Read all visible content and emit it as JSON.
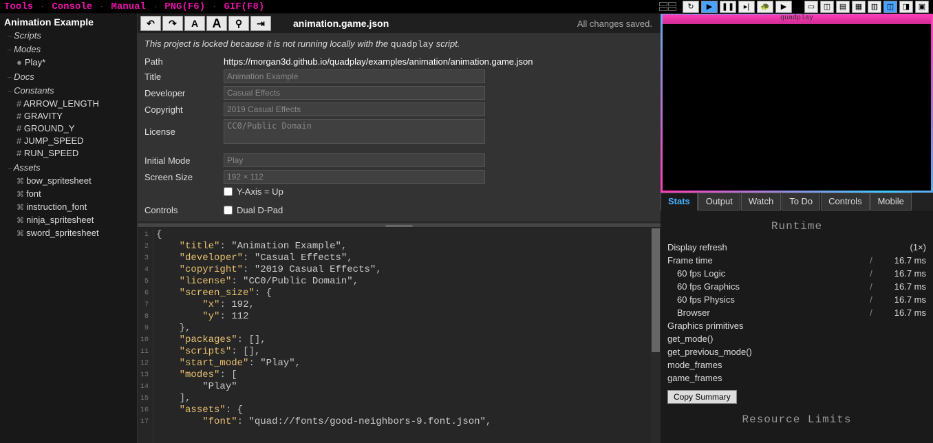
{
  "topmenu": [
    "Tools",
    "Console",
    "Manual",
    "PNG(F6)",
    "GIF(F8)"
  ],
  "project_title": "Animation Example",
  "sidebar": {
    "sections": [
      {
        "name": "Scripts",
        "items": []
      },
      {
        "name": "Modes",
        "items": [
          {
            "label": "Play*",
            "icon": "●"
          }
        ]
      },
      {
        "name": "Docs",
        "items": []
      },
      {
        "name": "Constants",
        "items": [
          "ARROW_LENGTH",
          "GRAVITY",
          "GROUND_Y",
          "JUMP_SPEED",
          "RUN_SPEED"
        ]
      },
      {
        "name": "Assets",
        "items": [
          "bow_spritesheet",
          "font",
          "instruction_font",
          "ninja_spritesheet",
          "sword_spritesheet"
        ]
      }
    ]
  },
  "editor": {
    "filename": "animation.game.json",
    "saved_msg": "All changes saved.",
    "lock_msg_prefix": "This project is locked because it is not running locally with the ",
    "lock_msg_script": "quadplay",
    "lock_msg_suffix": " script.",
    "toolbar_btns": [
      "↶",
      "↷",
      "A",
      "A",
      "⚲",
      "⇥"
    ],
    "fields": {
      "path_label": "Path",
      "path": "https://morgan3d.github.io/quadplay/examples/animation/animation.game.json",
      "title_label": "Title",
      "title": "Animation Example",
      "developer_label": "Developer",
      "developer": "Casual Effects",
      "copyright_label": "Copyright",
      "copyright": "2019 Casual Effects",
      "license_label": "License",
      "license": "CC0/Public Domain",
      "initmode_label": "Initial Mode",
      "initmode": "Play",
      "screensize_label": "Screen Size",
      "screensize": "192 × 112",
      "yaxis_label": "Y-Axis = Up",
      "controls_label": "Controls",
      "dualdpad_label": "Dual D-Pad"
    },
    "code_lines": [
      "{",
      "    \"title\": \"Animation Example\",",
      "    \"developer\": \"Casual Effects\",",
      "    \"copyright\": \"2019 Casual Effects\",",
      "    \"license\": \"CC0/Public Domain\",",
      "    \"screen_size\": {",
      "        \"x\": 192,",
      "        \"y\": 112",
      "    },",
      "    \"packages\": [],",
      "    \"scripts\": [],",
      "    \"start_mode\": \"Play\",",
      "    \"modes\": [",
      "        \"Play\"",
      "    ],",
      "    \"assets\": {",
      "        \"font\": \"quad://fonts/good-neighbors-9.font.json\","
    ]
  },
  "right": {
    "brand": "quadplay",
    "tabs": [
      "Stats",
      "Output",
      "Watch",
      "To Do",
      "Controls",
      "Mobile"
    ],
    "active_tab": 0,
    "runtime_title": "Runtime",
    "limits_title": "Resource Limits",
    "copy_label": "Copy Summary",
    "refresh_label": "Display refresh",
    "refresh_val": "(1×)",
    "rows": [
      {
        "label": "Frame time",
        "v1": "",
        "v2": "16.7 ms"
      },
      {
        "label": "60 fps Logic",
        "v1": "",
        "v2": "16.7 ms",
        "indent": true
      },
      {
        "label": "60 fps Graphics",
        "v1": "",
        "v2": "16.7 ms",
        "indent": true
      },
      {
        "label": "60 fps Physics",
        "v1": "",
        "v2": "16.7 ms",
        "indent": true
      },
      {
        "label": "Browser",
        "v1": "",
        "v2": "16.7 ms",
        "indent": true
      }
    ],
    "extras": [
      "Graphics primitives",
      "get_mode()",
      "get_previous_mode()",
      "mode_frames",
      "game_frames"
    ]
  }
}
